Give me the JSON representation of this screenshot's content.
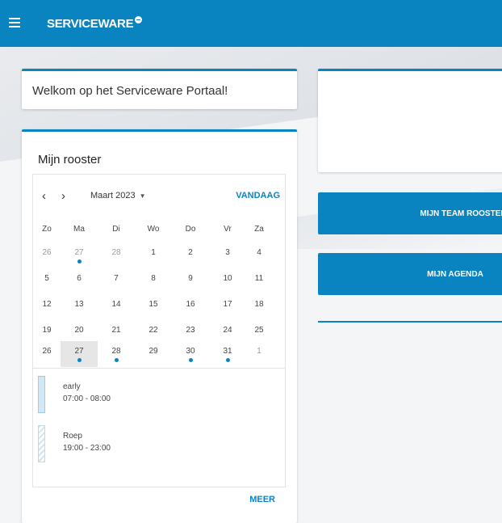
{
  "header": {
    "logo_text": "SERVICEWARE",
    "brand_color": "#0a84c1",
    "menu_icon": "hamburger-icon"
  },
  "welcome": {
    "text": "Welkom op het Serviceware Portaal!"
  },
  "roster": {
    "title": "Mijn rooster",
    "month_label": "Maart 2023",
    "today_label": "VANDAAG",
    "more_label": "MEER",
    "weekdays": [
      "Zo",
      "Ma",
      "Di",
      "Wo",
      "Do",
      "Vr",
      "Za"
    ],
    "weeks": [
      [
        "26",
        "27",
        "28",
        "1",
        "2",
        "3",
        "4"
      ],
      [
        "5",
        "6",
        "7",
        "8",
        "9",
        "10",
        "11"
      ],
      [
        "12",
        "13",
        "14",
        "15",
        "16",
        "17",
        "18"
      ],
      [
        "19",
        "20",
        "21",
        "22",
        "23",
        "24",
        "25"
      ],
      [
        "26",
        "27",
        "28",
        "29",
        "30",
        "31",
        "1"
      ]
    ],
    "events": [
      {
        "name": "early",
        "time": "07:00 - 08:00",
        "style": "solid"
      },
      {
        "name": "Roep",
        "time": "19:00 - 23:00",
        "style": "striped"
      }
    ]
  },
  "actions": {
    "team_roster_label": "MIJN TEAM ROOSTER",
    "agenda_label": "MIJN AGENDA"
  }
}
